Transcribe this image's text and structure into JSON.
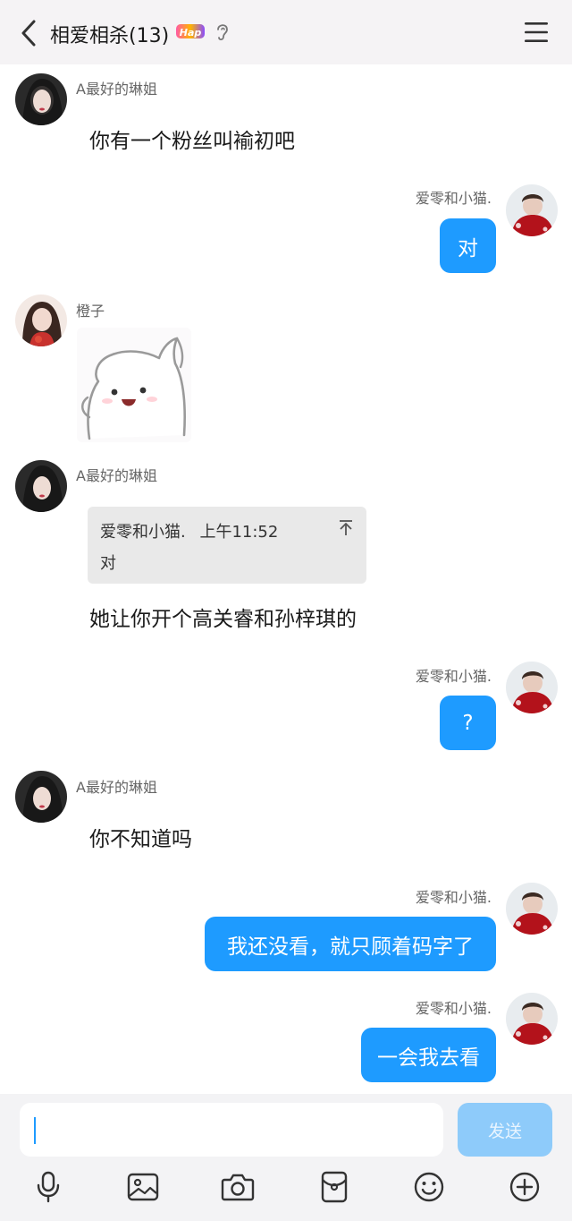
{
  "header": {
    "title": "相爱相杀(13)",
    "badge": "Hap"
  },
  "messages": [
    {
      "side": "left",
      "sender": "A最好的琳姐",
      "type": "text",
      "text": "你有一个粉丝叫褕初吧"
    },
    {
      "side": "right",
      "sender": "爱零和小猫.",
      "type": "bubble",
      "text": "对"
    },
    {
      "side": "left",
      "sender": "橙子",
      "type": "sticker"
    },
    {
      "side": "left",
      "sender": "A最好的琳姐",
      "type": "quote_text",
      "quote": {
        "author": "爱零和小猫.",
        "time": "上午11:52",
        "text": "对"
      },
      "text": "她让你开个高关睿和孙梓琪的"
    },
    {
      "side": "right",
      "sender": "爱零和小猫.",
      "type": "bubble",
      "text": "?"
    },
    {
      "side": "left",
      "sender": "A最好的琳姐",
      "type": "text",
      "text": "你不知道吗"
    },
    {
      "side": "right",
      "sender": "爱零和小猫.",
      "type": "bubble",
      "text": "我还没看，就只顾着码字了"
    },
    {
      "side": "right",
      "sender": "爱零和小猫.",
      "type": "bubble",
      "text": "一会我去看"
    }
  ],
  "input": {
    "value": "",
    "send_label": "发送"
  },
  "toolbar": [
    "microphone-icon",
    "image-icon",
    "camera-icon",
    "red-packet-icon",
    "emoji-icon",
    "plus-icon"
  ],
  "colors": {
    "accent": "#1e9bff",
    "send_disabled": "#8ecbfa",
    "header_bg": "#f5f3f5",
    "quote_bg": "#e9e9e9"
  }
}
